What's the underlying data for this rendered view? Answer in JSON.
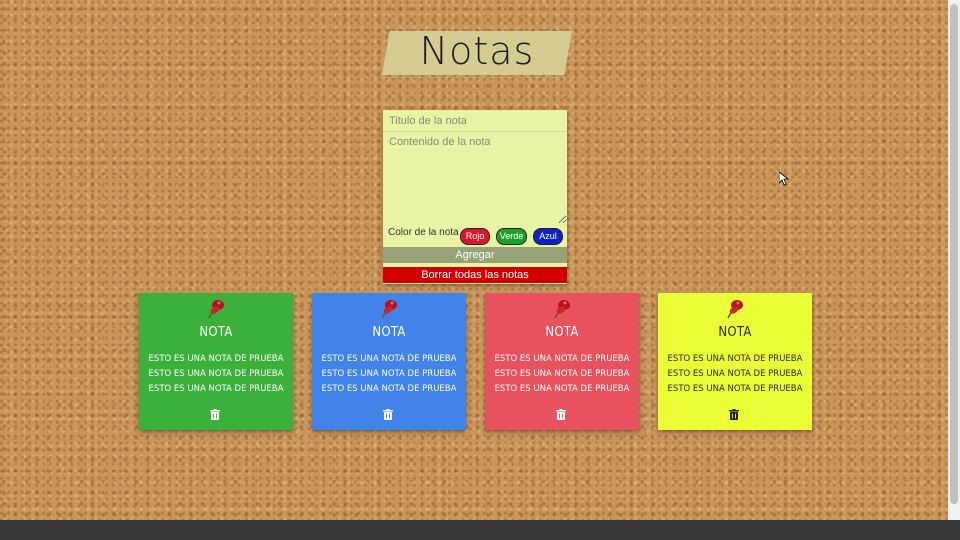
{
  "header": {
    "title": "Notas"
  },
  "form": {
    "title_placeholder": "Titulo de la nota",
    "content_placeholder": "Contenido de la nota",
    "color_label": "Color de la nota",
    "colors": [
      {
        "label": "Rojo",
        "hex": "#d7182b"
      },
      {
        "label": "Verde",
        "hex": "#19a025"
      },
      {
        "label": "Azul",
        "hex": "#1120c8"
      }
    ],
    "add_label": "Agregar",
    "delete_all_label": "Borrar todas las notas"
  },
  "notes": [
    {
      "title": "NOTA",
      "content": "Esto es una nota de prueba esto es una nota de prueba esto es una nota de prueba",
      "color": "#3bb13b",
      "pin_icon": "pushpin-icon",
      "delete_icon": "trash-icon"
    },
    {
      "title": "NOTA",
      "content": "Esto es una nota de prueba esto es una nota de prueba esto es una nota de prueba",
      "color": "#4183e9",
      "pin_icon": "pushpin-icon",
      "delete_icon": "trash-icon"
    },
    {
      "title": "NOTA",
      "content": "Esto es una nota de prueba esto es una nota de prueba esto es una nota de prueba",
      "color": "#e8515e",
      "pin_icon": "pushpin-icon",
      "delete_icon": "trash-icon"
    },
    {
      "title": "NOTA",
      "content": "Esto es una nota de prueba esto es una nota de prueba esto es una nota de prueba",
      "color": "#e9fc35",
      "pin_icon": "pushpin-icon",
      "delete_icon": "trash-icon"
    }
  ],
  "theme": {
    "background": "cork",
    "footer_color": "#383838"
  }
}
